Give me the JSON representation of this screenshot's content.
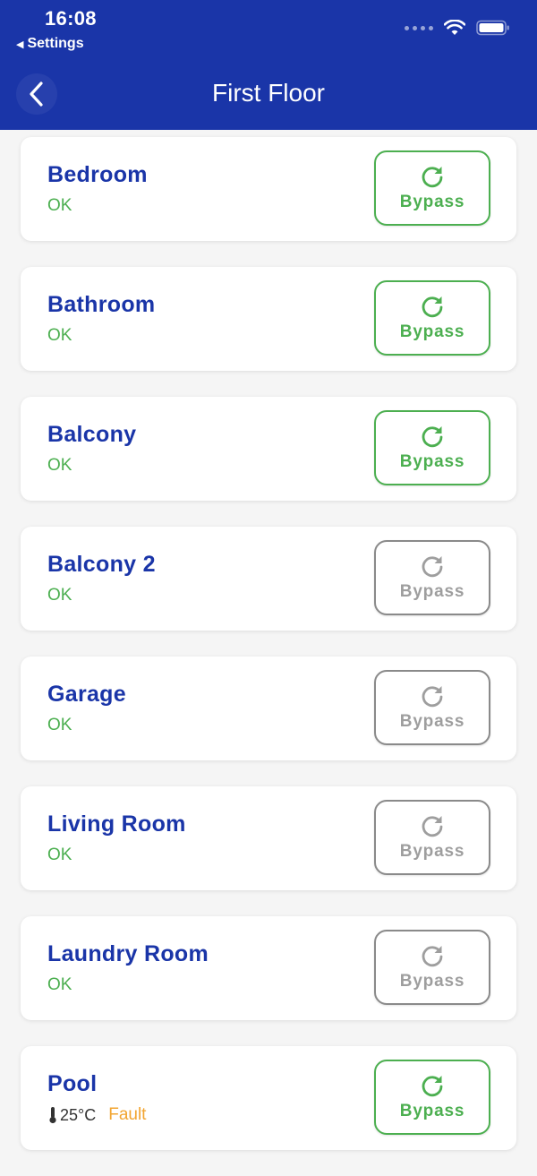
{
  "status_bar": {
    "time": "16:08",
    "back_label": "Settings"
  },
  "header": {
    "title": "First Floor"
  },
  "colors": {
    "header_bg": "#1a35a8",
    "ok_green": "#4caf50",
    "disabled_gray": "#9e9e9e",
    "fault_orange": "#f2a531"
  },
  "rooms": [
    {
      "name": "Bedroom",
      "status": "OK",
      "bypass_label": "Bypass",
      "bypass_enabled": true
    },
    {
      "name": "Bathroom",
      "status": "OK",
      "bypass_label": "Bypass",
      "bypass_enabled": true
    },
    {
      "name": "Balcony",
      "status": "OK",
      "bypass_label": "Bypass",
      "bypass_enabled": true
    },
    {
      "name": "Balcony 2",
      "status": "OK",
      "bypass_label": "Bypass",
      "bypass_enabled": false
    },
    {
      "name": "Garage",
      "status": "OK",
      "bypass_label": "Bypass",
      "bypass_enabled": false
    },
    {
      "name": "Living Room",
      "status": "OK",
      "bypass_label": "Bypass",
      "bypass_enabled": false
    },
    {
      "name": "Laundry Room",
      "status": "OK",
      "bypass_label": "Bypass",
      "bypass_enabled": false
    },
    {
      "name": "Pool",
      "temperature": "25°C",
      "fault": "Fault",
      "bypass_label": "Bypass",
      "bypass_enabled": true
    }
  ]
}
